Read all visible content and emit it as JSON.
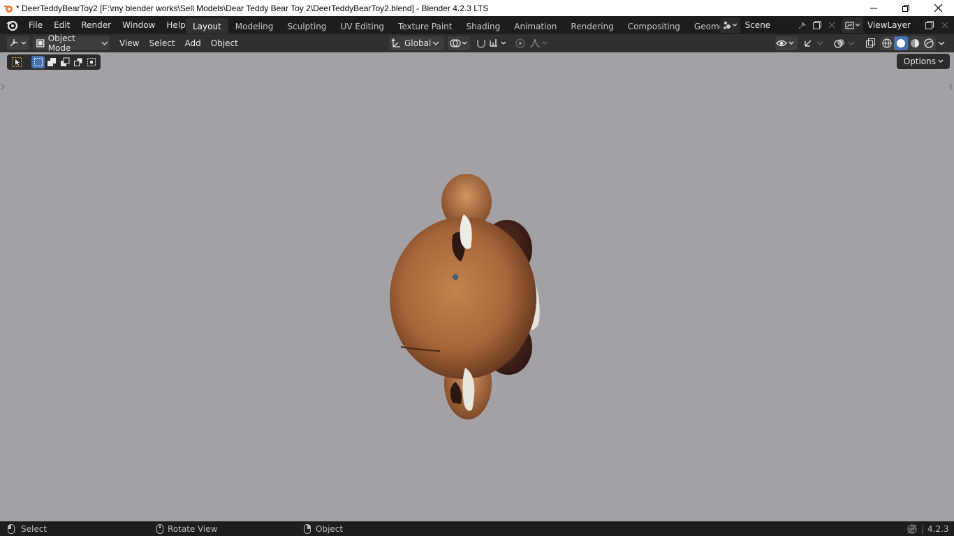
{
  "window": {
    "title": "* DeerTeddyBearToy2 [F:\\my blender works\\Sell Models\\Dear Teddy Bear Toy 2\\DeerTeddyBearToy2.blend] - Blender 4.2.3 LTS",
    "controls": [
      "minimize-icon",
      "restore-icon",
      "close-icon"
    ]
  },
  "menu": {
    "items": [
      "File",
      "Edit",
      "Render",
      "Window",
      "Help"
    ]
  },
  "workspaces": {
    "tabs": [
      "Layout",
      "Modeling",
      "Sculpting",
      "UV Editing",
      "Texture Paint",
      "Shading",
      "Animation",
      "Rendering",
      "Compositing",
      "Geometry Nodes"
    ],
    "active": "Layout"
  },
  "scene": {
    "name": "Scene"
  },
  "view_layer": {
    "name": "ViewLayer"
  },
  "viewport_header": {
    "mode": "Object Mode",
    "menus": [
      "View",
      "Select",
      "Add",
      "Object"
    ],
    "transform_orientation": "Global"
  },
  "viewport": {
    "options_label": "Options",
    "background_color": "#a3a1a5"
  },
  "statusbar": {
    "left_click": "Select",
    "middle_click": "Rotate View",
    "right_click": "Object",
    "version": "4.2.3"
  },
  "colors": {
    "accent_active": "#4772b3",
    "header_bg": "#303030",
    "topbar_bg": "#1d1d1d"
  }
}
